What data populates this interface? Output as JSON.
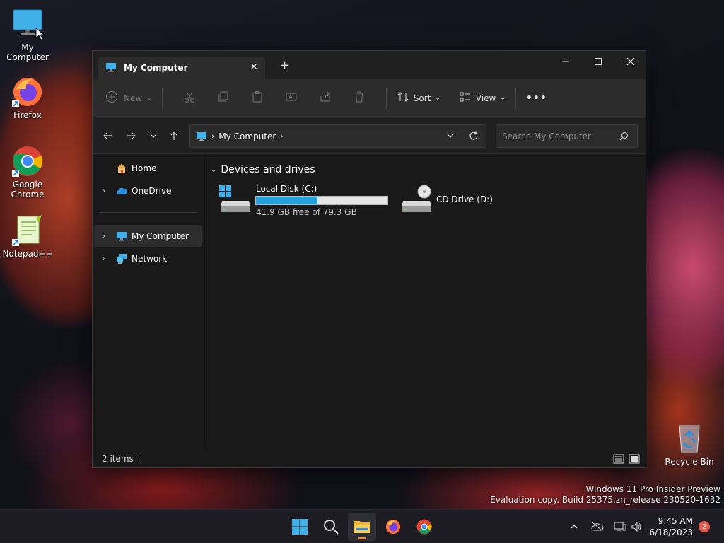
{
  "desktop": {
    "icons": [
      {
        "label": "My Computer",
        "icon": "monitor-icon"
      },
      {
        "label": "Firefox",
        "icon": "firefox-icon"
      },
      {
        "label": "Google Chrome",
        "icon": "chrome-icon"
      },
      {
        "label": "Notepad++",
        "icon": "notepadpp-icon"
      },
      {
        "label": "Recycle Bin",
        "icon": "recycle-bin-icon"
      }
    ]
  },
  "window": {
    "tab_title": "My Computer",
    "commands": {
      "new": "New",
      "sort": "Sort",
      "view": "View",
      "more": "•••"
    },
    "address": {
      "crumb": "My Computer"
    },
    "search": {
      "placeholder": "Search My Computer"
    },
    "sidebar": {
      "items": [
        {
          "label": "Home"
        },
        {
          "label": "OneDrive"
        },
        {
          "label": "My Computer"
        },
        {
          "label": "Network"
        }
      ]
    },
    "content": {
      "section_title": "Devices and drives",
      "drives": [
        {
          "name": "Local Disk (C:)",
          "free_text": "41.9 GB free of 79.3 GB",
          "used_fraction": 0.47
        },
        {
          "name": "CD Drive (D:)"
        }
      ]
    },
    "status": {
      "items_count": "2 items"
    }
  },
  "watermark": {
    "line1": "Windows 11 Pro Insider Preview",
    "line2": "Evaluation copy. Build 25375.zn_release.230520-1632"
  },
  "taskbar": {
    "time": "9:45 AM",
    "date": "6/18/2023",
    "notifications": "2"
  },
  "colors": {
    "accent": "#26a0da",
    "window_bg": "#191919",
    "taskbar_indicator": "#e8913a"
  }
}
